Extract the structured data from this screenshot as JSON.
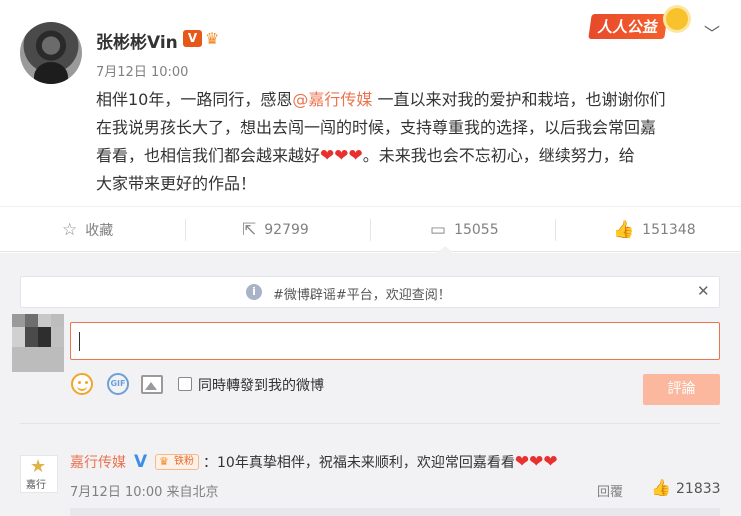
{
  "post": {
    "author": "张彬彬Vin",
    "vip_badge": "V",
    "crown_icon": "crown-icon",
    "time": "7月12日 10:00",
    "badge_label": "人人公益",
    "content_before_at": "相伴10年，一路同行，感恩",
    "mention": "@嘉行传媒",
    "content_line1_after": " 一直以来对我的爱护和栽培，也谢谢你们",
    "content_line2": "在我说男孩长大了，想出去闯一闯的时候，支持尊重我的选择，以后我会常回嘉",
    "content_line3_before": "看看，也相信我们都会越来越好",
    "hearts": "❤❤❤",
    "content_line3_after": "。未来我也会不忘初心，继续努力，给",
    "content_line4": "大家带来更好的作品！"
  },
  "actions": {
    "favorite_label": "收藏",
    "repost_count": "92799",
    "comment_count": "15055",
    "like_count": "151348"
  },
  "notice": {
    "text": "#微博辟谣#平台，欢迎查阅！"
  },
  "composer": {
    "input_value": "",
    "repost_label": "同時轉發到我的微博",
    "submit_label": "評論"
  },
  "comment": {
    "avatar_text": "嘉行",
    "author": "嘉行传媒",
    "fan_badge": "铁粉",
    "text": "：10年真挚相伴，祝福未来顺利，欢迎常回嘉看看",
    "hearts": "❤❤❤",
    "time": "7月12日 10:00 来自北京",
    "reply_label": "回覆",
    "like_count": "21833"
  },
  "colors": {
    "accent": "#eb7350",
    "submit_disabled": "#fbb89e",
    "heart": "#e8312e",
    "verified_blue": "#3e8ee6"
  }
}
